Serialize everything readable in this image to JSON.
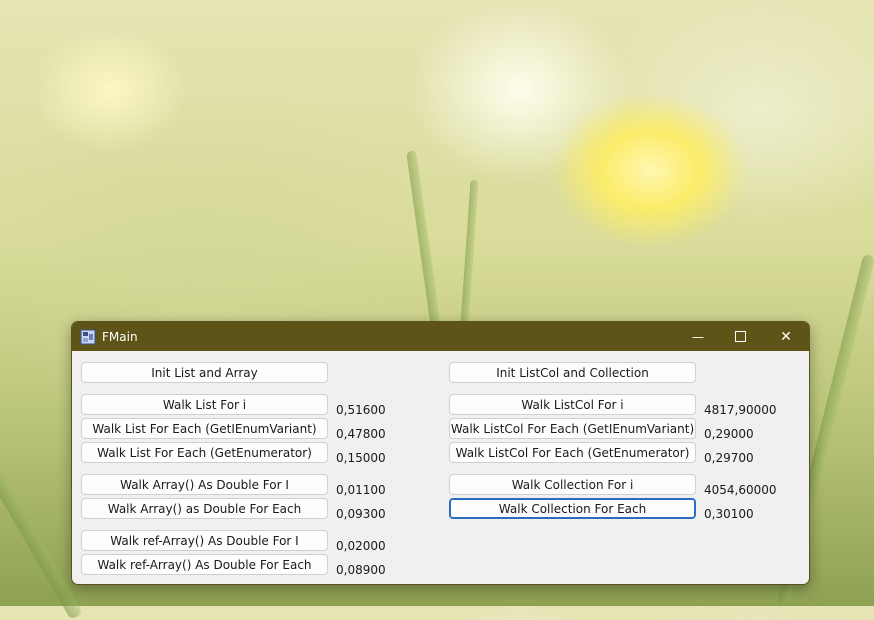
{
  "window": {
    "title": "FMain",
    "min_glyph": "—",
    "max_glyph": "☐",
    "close_glyph": "✕"
  },
  "left": {
    "init_label": "Init List and Array",
    "rows": [
      {
        "label": "Walk List For i",
        "value": "0,51600"
      },
      {
        "label": "Walk List For Each (GetIEnumVariant)",
        "value": "0,47800"
      },
      {
        "label": "Walk List For Each (GetEnumerator)",
        "value": "0,15000"
      },
      {
        "label": "Walk Array() As Double For I",
        "value": "0,01100"
      },
      {
        "label": "Walk Array() as Double For Each",
        "value": "0,09300"
      },
      {
        "label": "Walk ref-Array() As Double For I",
        "value": "0,02000"
      },
      {
        "label": "Walk ref-Array() As Double For Each",
        "value": "0,08900"
      }
    ]
  },
  "right": {
    "init_label": "Init ListCol and Collection",
    "rows": [
      {
        "label": "Walk ListCol For i",
        "value": "4817,90000"
      },
      {
        "label": "Walk ListCol For Each (GetIEnumVariant)",
        "value": "0,29000"
      },
      {
        "label": "Walk ListCol For Each (GetEnumerator)",
        "value": "0,29700"
      },
      {
        "label": "Walk Collection For i",
        "value": "4054,60000"
      },
      {
        "label": "Walk Collection For Each",
        "value": "0,30100"
      }
    ]
  }
}
